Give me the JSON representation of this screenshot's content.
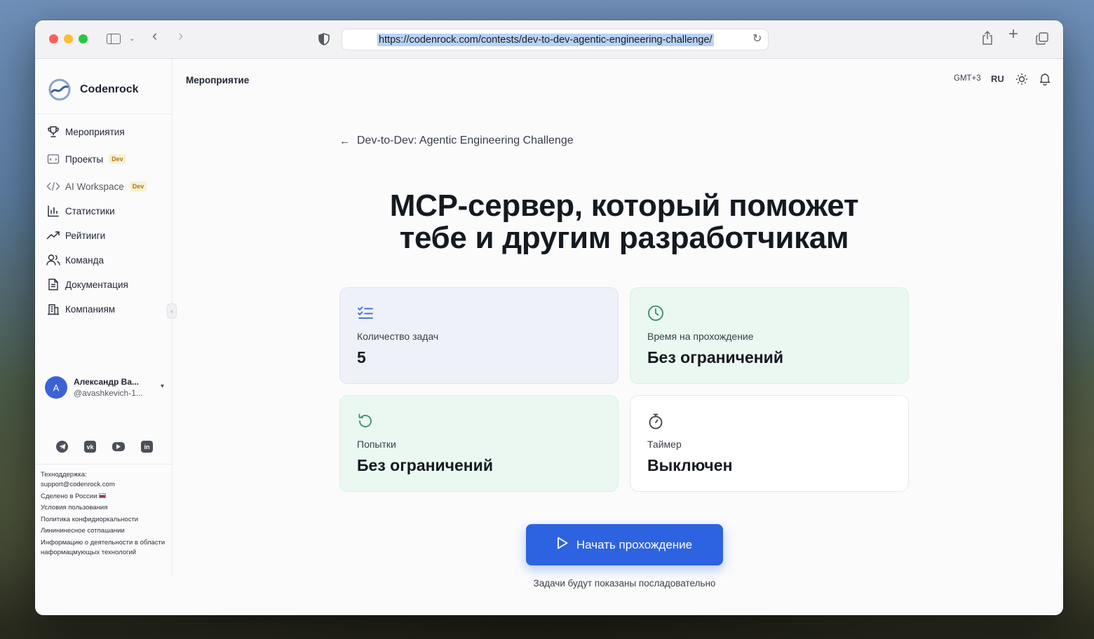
{
  "browser": {
    "url": "https://codenrock.com/contests/dev-to-dev-agentic-engineering-challenge/"
  },
  "sidebar": {
    "brand": "Codenrock",
    "items": [
      {
        "label": "Мероприятия",
        "icon": "trophy-icon"
      },
      {
        "label": "Проекты",
        "icon": "folder-icon",
        "badge": "Dev"
      },
      {
        "label": "AI Workspace",
        "icon": "code-icon",
        "badge": "Dev"
      },
      {
        "label": "Статистики",
        "icon": "bar-chart-icon"
      },
      {
        "label": "Рейтииги",
        "icon": "trend-icon"
      },
      {
        "label": "Команда",
        "icon": "users-icon"
      },
      {
        "label": "Документация",
        "icon": "document-icon"
      },
      {
        "label": "Компаниям",
        "icon": "building-icon"
      }
    ],
    "user": {
      "initial": "A",
      "name": "Александр Ва...",
      "handle": "@avashkevich-1..."
    },
    "socials": [
      "telegram-icon",
      "vk-icon",
      "youtube-icon",
      "linkedin-icon"
    ],
    "footer": {
      "support_label": "Техноддержка:",
      "support_email": "support@codenrock.com",
      "made_in": "Сделено в России",
      "terms": "Условия пользования",
      "privacy": "Политика конфидиоркальности",
      "license": "Линининесное сотпашании",
      "it_info": "Информацию о деятельности в области наформацмующых технологий"
    }
  },
  "header": {
    "title": "Мероприятие",
    "timezone": "GMT+3",
    "language": "RU"
  },
  "main": {
    "breadcrumb": "Dev-to-Dev: Agentic Engineering Challenge",
    "title_line1": "МСР-сервер, который поможет",
    "title_line2": "тебе и другим разработчикам",
    "cards": [
      {
        "label": "Количество задач",
        "value": "5",
        "icon": "checklist-icon"
      },
      {
        "label": "Время на прохождение",
        "value": "Без ограничений",
        "icon": "clock-icon"
      },
      {
        "label": "Попытки",
        "value": "Без ограничений",
        "icon": "retry-icon"
      },
      {
        "label": "Таймер",
        "value": "Выключен",
        "icon": "stopwatch-icon"
      }
    ],
    "start_button": "Начать прохождение",
    "hint": "Задачи будут показаны посладовательно"
  },
  "colors": {
    "primary": "#2d63e0",
    "card_blue": "#eef2f8",
    "card_green": "#eaf8f1",
    "icon_green": "#3d8a6a",
    "icon_blue": "#3a63d8"
  }
}
